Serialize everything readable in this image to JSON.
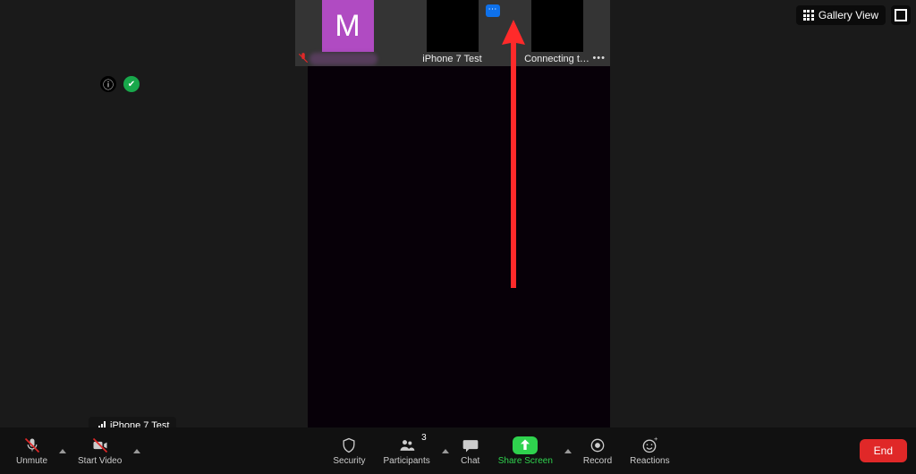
{
  "view_toggle": {
    "label": "Gallery View"
  },
  "thumbs": [
    {
      "letter": "M",
      "name": ""
    },
    {
      "name": "iPhone 7 Test"
    },
    {
      "name": "Connecting t…"
    }
  ],
  "badges": {
    "info": "ⓘ",
    "shield": "✔"
  },
  "tooltip": {
    "text": "iPhone 7 Test"
  },
  "toolbar": {
    "unmute": "Unmute",
    "start_video": "Start Video",
    "security": "Security",
    "participants": "Participants",
    "participants_count": "3",
    "chat": "Chat",
    "share_screen": "Share Screen",
    "record": "Record",
    "reactions": "Reactions",
    "end": "End"
  },
  "menu_dots": "⋯"
}
